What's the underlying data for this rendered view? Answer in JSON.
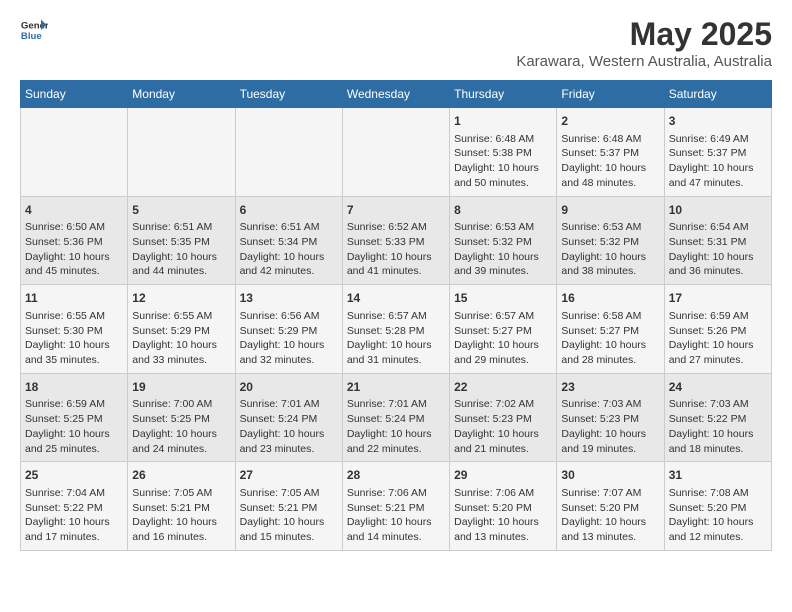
{
  "header": {
    "logo_general": "General",
    "logo_blue": "Blue",
    "main_title": "May 2025",
    "subtitle": "Karawara, Western Australia, Australia"
  },
  "days_of_week": [
    "Sunday",
    "Monday",
    "Tuesday",
    "Wednesday",
    "Thursday",
    "Friday",
    "Saturday"
  ],
  "weeks": [
    {
      "days": [
        {
          "num": "",
          "info": ""
        },
        {
          "num": "",
          "info": ""
        },
        {
          "num": "",
          "info": ""
        },
        {
          "num": "",
          "info": ""
        },
        {
          "num": "1",
          "info": "Sunrise: 6:48 AM\nSunset: 5:38 PM\nDaylight: 10 hours\nand 50 minutes."
        },
        {
          "num": "2",
          "info": "Sunrise: 6:48 AM\nSunset: 5:37 PM\nDaylight: 10 hours\nand 48 minutes."
        },
        {
          "num": "3",
          "info": "Sunrise: 6:49 AM\nSunset: 5:37 PM\nDaylight: 10 hours\nand 47 minutes."
        }
      ]
    },
    {
      "days": [
        {
          "num": "4",
          "info": "Sunrise: 6:50 AM\nSunset: 5:36 PM\nDaylight: 10 hours\nand 45 minutes."
        },
        {
          "num": "5",
          "info": "Sunrise: 6:51 AM\nSunset: 5:35 PM\nDaylight: 10 hours\nand 44 minutes."
        },
        {
          "num": "6",
          "info": "Sunrise: 6:51 AM\nSunset: 5:34 PM\nDaylight: 10 hours\nand 42 minutes."
        },
        {
          "num": "7",
          "info": "Sunrise: 6:52 AM\nSunset: 5:33 PM\nDaylight: 10 hours\nand 41 minutes."
        },
        {
          "num": "8",
          "info": "Sunrise: 6:53 AM\nSunset: 5:32 PM\nDaylight: 10 hours\nand 39 minutes."
        },
        {
          "num": "9",
          "info": "Sunrise: 6:53 AM\nSunset: 5:32 PM\nDaylight: 10 hours\nand 38 minutes."
        },
        {
          "num": "10",
          "info": "Sunrise: 6:54 AM\nSunset: 5:31 PM\nDaylight: 10 hours\nand 36 minutes."
        }
      ]
    },
    {
      "days": [
        {
          "num": "11",
          "info": "Sunrise: 6:55 AM\nSunset: 5:30 PM\nDaylight: 10 hours\nand 35 minutes."
        },
        {
          "num": "12",
          "info": "Sunrise: 6:55 AM\nSunset: 5:29 PM\nDaylight: 10 hours\nand 33 minutes."
        },
        {
          "num": "13",
          "info": "Sunrise: 6:56 AM\nSunset: 5:29 PM\nDaylight: 10 hours\nand 32 minutes."
        },
        {
          "num": "14",
          "info": "Sunrise: 6:57 AM\nSunset: 5:28 PM\nDaylight: 10 hours\nand 31 minutes."
        },
        {
          "num": "15",
          "info": "Sunrise: 6:57 AM\nSunset: 5:27 PM\nDaylight: 10 hours\nand 29 minutes."
        },
        {
          "num": "16",
          "info": "Sunrise: 6:58 AM\nSunset: 5:27 PM\nDaylight: 10 hours\nand 28 minutes."
        },
        {
          "num": "17",
          "info": "Sunrise: 6:59 AM\nSunset: 5:26 PM\nDaylight: 10 hours\nand 27 minutes."
        }
      ]
    },
    {
      "days": [
        {
          "num": "18",
          "info": "Sunrise: 6:59 AM\nSunset: 5:25 PM\nDaylight: 10 hours\nand 25 minutes."
        },
        {
          "num": "19",
          "info": "Sunrise: 7:00 AM\nSunset: 5:25 PM\nDaylight: 10 hours\nand 24 minutes."
        },
        {
          "num": "20",
          "info": "Sunrise: 7:01 AM\nSunset: 5:24 PM\nDaylight: 10 hours\nand 23 minutes."
        },
        {
          "num": "21",
          "info": "Sunrise: 7:01 AM\nSunset: 5:24 PM\nDaylight: 10 hours\nand 22 minutes."
        },
        {
          "num": "22",
          "info": "Sunrise: 7:02 AM\nSunset: 5:23 PM\nDaylight: 10 hours\nand 21 minutes."
        },
        {
          "num": "23",
          "info": "Sunrise: 7:03 AM\nSunset: 5:23 PM\nDaylight: 10 hours\nand 19 minutes."
        },
        {
          "num": "24",
          "info": "Sunrise: 7:03 AM\nSunset: 5:22 PM\nDaylight: 10 hours\nand 18 minutes."
        }
      ]
    },
    {
      "days": [
        {
          "num": "25",
          "info": "Sunrise: 7:04 AM\nSunset: 5:22 PM\nDaylight: 10 hours\nand 17 minutes."
        },
        {
          "num": "26",
          "info": "Sunrise: 7:05 AM\nSunset: 5:21 PM\nDaylight: 10 hours\nand 16 minutes."
        },
        {
          "num": "27",
          "info": "Sunrise: 7:05 AM\nSunset: 5:21 PM\nDaylight: 10 hours\nand 15 minutes."
        },
        {
          "num": "28",
          "info": "Sunrise: 7:06 AM\nSunset: 5:21 PM\nDaylight: 10 hours\nand 14 minutes."
        },
        {
          "num": "29",
          "info": "Sunrise: 7:06 AM\nSunset: 5:20 PM\nDaylight: 10 hours\nand 13 minutes."
        },
        {
          "num": "30",
          "info": "Sunrise: 7:07 AM\nSunset: 5:20 PM\nDaylight: 10 hours\nand 13 minutes."
        },
        {
          "num": "31",
          "info": "Sunrise: 7:08 AM\nSunset: 5:20 PM\nDaylight: 10 hours\nand 12 minutes."
        }
      ]
    }
  ]
}
